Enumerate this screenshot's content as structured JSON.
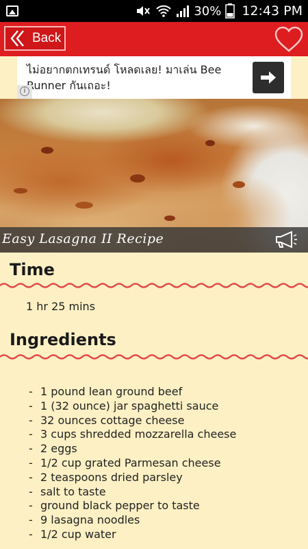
{
  "status_bar": {
    "battery_percent": "30%",
    "time": "12:43 PM",
    "icons": [
      "gallery-icon",
      "mute-icon",
      "wifi-icon",
      "signal-icon",
      "battery-icon"
    ]
  },
  "header": {
    "back_label": "Back",
    "icons": [
      "double-chevron-left-icon",
      "heart-icon"
    ],
    "accent_color": "#dd1d1f"
  },
  "ad": {
    "text": "ไม่อยากตกเทรนด์ โหลดเลย! มาเล่น Bee Runner กันเถอะ!",
    "icons": [
      "info-icon",
      "arrow-right-icon"
    ]
  },
  "recipe": {
    "title": "Easy Lasagna II Recipe",
    "icons": [
      "megaphone-icon"
    ]
  },
  "time_section": {
    "heading": "Time",
    "value": "1 hr 25 mins"
  },
  "ingredients_section": {
    "heading": "Ingredients",
    "items": [
      "1 pound lean ground beef",
      "1 (32 ounce) jar spaghetti sauce",
      "32 ounces cottage cheese",
      "3 cups shredded mozzarella cheese",
      "2 eggs",
      "1/2 cup grated Parmesan cheese",
      "2 teaspoons dried parsley",
      "salt to taste",
      "ground black pepper to taste",
      "9 lasagna noodles",
      "1/2 cup water"
    ]
  },
  "colors": {
    "background": "#fcf0c4",
    "wave": "#e34a4a"
  }
}
